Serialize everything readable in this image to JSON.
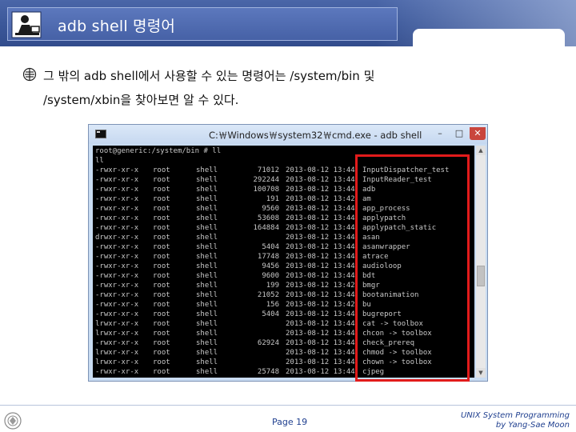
{
  "slide": {
    "title": "adb shell 명령어",
    "bullet_line1": "그 밖의 adb shell에서 사용할 수 있는 명령어는 /system/bin 및",
    "bullet_line2": "/system/xbin을 찾아보면 알 수 있다."
  },
  "cmd_window": {
    "title": "C:￦Windows￦system32￦cmd.exe - adb  shell",
    "controls": {
      "minimize": "–",
      "maximize": "□",
      "close": "✕"
    },
    "scroll_up": "▲",
    "scroll_down": "▼",
    "console_header": [
      "root@generic:/system/bin # ll",
      "ll"
    ],
    "rows": [
      {
        "perm": "-rwxr-xr-x",
        "owner": "root",
        "group": "shell",
        "size": "71012",
        "date": "2013-08-12 13:44",
        "name": "InputDispatcher_test"
      },
      {
        "perm": "-rwxr-xr-x",
        "owner": "root",
        "group": "shell",
        "size": "292244",
        "date": "2013-08-12 13:44",
        "name": "InputReader_test"
      },
      {
        "perm": "-rwxr-xr-x",
        "owner": "root",
        "group": "shell",
        "size": "100708",
        "date": "2013-08-12 13:44",
        "name": "adb"
      },
      {
        "perm": "-rwxr-xr-x",
        "owner": "root",
        "group": "shell",
        "size": "191",
        "date": "2013-08-12 13:42",
        "name": "am"
      },
      {
        "perm": "-rwxr-xr-x",
        "owner": "root",
        "group": "shell",
        "size": "9560",
        "date": "2013-08-12 13:44",
        "name": "app_process"
      },
      {
        "perm": "-rwxr-xr-x",
        "owner": "root",
        "group": "shell",
        "size": "53608",
        "date": "2013-08-12 13:44",
        "name": "applypatch"
      },
      {
        "perm": "-rwxr-xr-x",
        "owner": "root",
        "group": "shell",
        "size": "164884",
        "date": "2013-08-12 13:44",
        "name": "applypatch_static"
      },
      {
        "perm": "drwxr-xr-x",
        "owner": "root",
        "group": "shell",
        "size": "",
        "date": "2013-08-12 13:44",
        "name": "asan"
      },
      {
        "perm": "-rwxr-xr-x",
        "owner": "root",
        "group": "shell",
        "size": "5404",
        "date": "2013-08-12 13:44",
        "name": "asanwrapper"
      },
      {
        "perm": "-rwxr-xr-x",
        "owner": "root",
        "group": "shell",
        "size": "17748",
        "date": "2013-08-12 13:44",
        "name": "atrace"
      },
      {
        "perm": "-rwxr-xr-x",
        "owner": "root",
        "group": "shell",
        "size": "9456",
        "date": "2013-08-12 13:44",
        "name": "audioloop"
      },
      {
        "perm": "-rwxr-xr-x",
        "owner": "root",
        "group": "shell",
        "size": "9600",
        "date": "2013-08-12 13:44",
        "name": "bdt"
      },
      {
        "perm": "-rwxr-xr-x",
        "owner": "root",
        "group": "shell",
        "size": "199",
        "date": "2013-08-12 13:42",
        "name": "bmgr"
      },
      {
        "perm": "-rwxr-xr-x",
        "owner": "root",
        "group": "shell",
        "size": "21052",
        "date": "2013-08-12 13:44",
        "name": "bootanimation"
      },
      {
        "perm": "-rwxr-xr-x",
        "owner": "root",
        "group": "shell",
        "size": "156",
        "date": "2013-08-12 13:42",
        "name": "bu"
      },
      {
        "perm": "-rwxr-xr-x",
        "owner": "root",
        "group": "shell",
        "size": "5404",
        "date": "2013-08-12 13:44",
        "name": "bugreport"
      },
      {
        "perm": "lrwxr-xr-x",
        "owner": "root",
        "group": "shell",
        "size": "",
        "date": "2013-08-12 13:44",
        "name": "cat -> toolbox"
      },
      {
        "perm": "lrwxr-xr-x",
        "owner": "root",
        "group": "shell",
        "size": "",
        "date": "2013-08-12 13:44",
        "name": "chcon -> toolbox"
      },
      {
        "perm": "-rwxr-xr-x",
        "owner": "root",
        "group": "shell",
        "size": "62924",
        "date": "2013-08-12 13:44",
        "name": "check_prereq"
      },
      {
        "perm": "lrwxr-xr-x",
        "owner": "root",
        "group": "shell",
        "size": "",
        "date": "2013-08-12 13:44",
        "name": "chmod -> toolbox"
      },
      {
        "perm": "lrwxr-xr-x",
        "owner": "root",
        "group": "shell",
        "size": "",
        "date": "2013-08-12 13:44",
        "name": "chown -> toolbox"
      },
      {
        "perm": "-rwxr-xr-x",
        "owner": "root",
        "group": "shell",
        "size": "25748",
        "date": "2013-08-12 13:44",
        "name": "cjpeg"
      }
    ]
  },
  "footer": {
    "page": "Page 19",
    "right_line1": "UNIX System Programming",
    "right_line2": "by Yang-Sae Moon"
  },
  "colors": {
    "title_band": "#3b5799",
    "highlight": "#e21b1b",
    "footer_text": "#1f3f8f",
    "console_bg": "#000000"
  }
}
